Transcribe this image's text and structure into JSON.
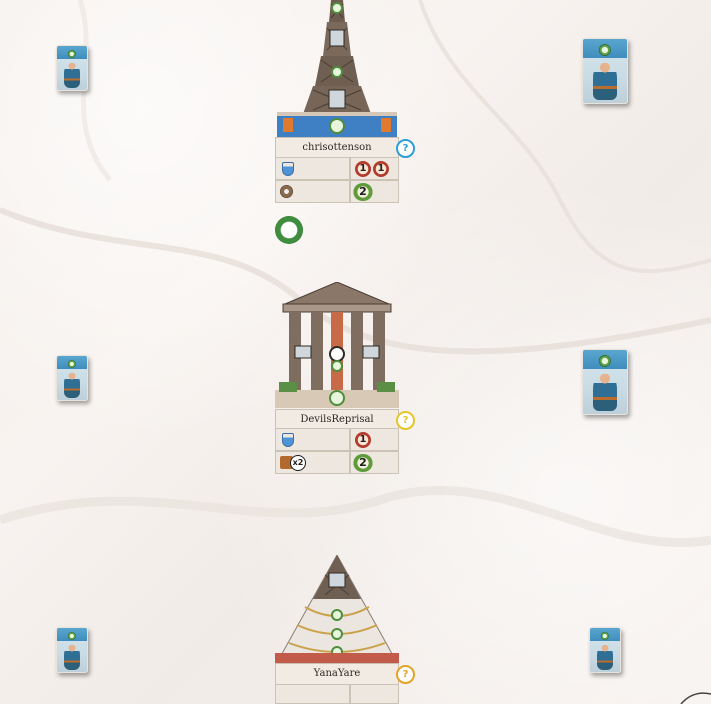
{
  "players": [
    {
      "name": "chrisottenson",
      "help_icon": "question-icon",
      "help_color": "#2b9fd6",
      "help_symbol": "?",
      "resources": {
        "science_icon": "flask-icon",
        "coins": [
          "1",
          "1"
        ],
        "gear_icon": "gear-icon",
        "laurel_points": "2"
      },
      "progress_token_icon": "progress-token-icon"
    },
    {
      "name": "DevilsReprisal",
      "help_icon": "question-icon",
      "help_color": "#e6c52b",
      "help_symbol": "?",
      "resources": {
        "science_icon": "flask-icon",
        "coins": [
          "1"
        ],
        "multiplier": "x2",
        "laurel_points": "2"
      }
    },
    {
      "name": "YanaYare",
      "help_icon": "question-icon",
      "help_color": "#e3a326",
      "help_symbol": "?"
    }
  ],
  "colors": {
    "accent_blue": "#3f8dbd",
    "coin_red": "#b33b2c",
    "laurel_green": "#5f9b3a"
  }
}
